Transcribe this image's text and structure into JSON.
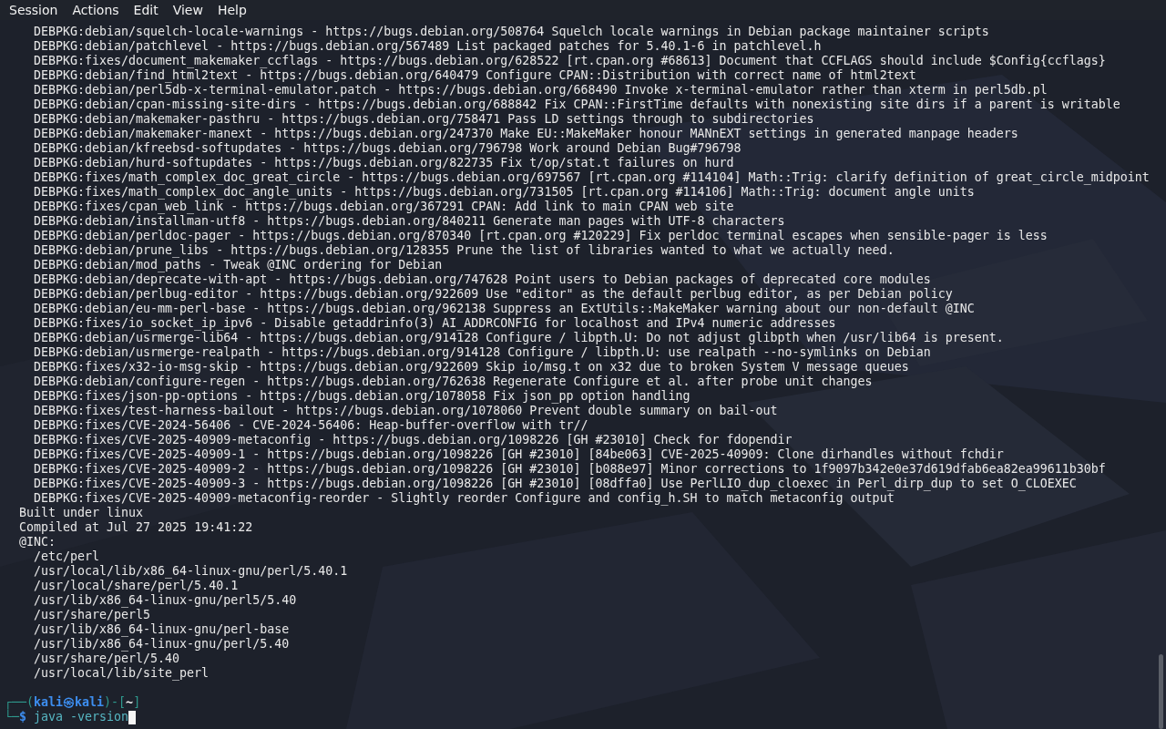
{
  "menu": [
    "Session",
    "Actions",
    "Edit",
    "View",
    "Help"
  ],
  "patches": [
    "DEBPKG:debian/squelch-locale-warnings - https://bugs.debian.org/508764 Squelch locale warnings in Debian package maintainer scripts",
    "DEBPKG:debian/patchlevel - https://bugs.debian.org/567489 List packaged patches for 5.40.1-6 in patchlevel.h",
    "DEBPKG:fixes/document_makemaker_ccflags - https://bugs.debian.org/628522 [rt.cpan.org #68613] Document that CCFLAGS should include $Config{ccflags}",
    "DEBPKG:debian/find_html2text - https://bugs.debian.org/640479 Configure CPAN::Distribution with correct name of html2text",
    "DEBPKG:debian/perl5db-x-terminal-emulator.patch - https://bugs.debian.org/668490 Invoke x-terminal-emulator rather than xterm in perl5db.pl",
    "DEBPKG:debian/cpan-missing-site-dirs - https://bugs.debian.org/688842 Fix CPAN::FirstTime defaults with nonexisting site dirs if a parent is writable",
    "DEBPKG:debian/makemaker-pasthru - https://bugs.debian.org/758471 Pass LD settings through to subdirectories",
    "DEBPKG:debian/makemaker-manext - https://bugs.debian.org/247370 Make EU::MakeMaker honour MANnEXT settings in generated manpage headers",
    "DEBPKG:debian/kfreebsd-softupdates - https://bugs.debian.org/796798 Work around Debian Bug#796798",
    "DEBPKG:debian/hurd-softupdates - https://bugs.debian.org/822735 Fix t/op/stat.t failures on hurd",
    "DEBPKG:fixes/math_complex_doc_great_circle - https://bugs.debian.org/697567 [rt.cpan.org #114104] Math::Trig: clarify definition of great_circle_midpoint",
    "DEBPKG:fixes/math_complex_doc_angle_units - https://bugs.debian.org/731505 [rt.cpan.org #114106] Math::Trig: document angle units",
    "DEBPKG:fixes/cpan_web_link - https://bugs.debian.org/367291 CPAN: Add link to main CPAN web site",
    "DEBPKG:debian/installman-utf8 - https://bugs.debian.org/840211 Generate man pages with UTF-8 characters",
    "DEBPKG:debian/perldoc-pager - https://bugs.debian.org/870340 [rt.cpan.org #120229] Fix perldoc terminal escapes when sensible-pager is less",
    "DEBPKG:debian/prune_libs - https://bugs.debian.org/128355 Prune the list of libraries wanted to what we actually need.",
    "DEBPKG:debian/mod_paths - Tweak @INC ordering for Debian",
    "DEBPKG:debian/deprecate-with-apt - https://bugs.debian.org/747628 Point users to Debian packages of deprecated core modules",
    "DEBPKG:debian/perlbug-editor - https://bugs.debian.org/922609 Use \"editor\" as the default perlbug editor, as per Debian policy",
    "DEBPKG:debian/eu-mm-perl-base - https://bugs.debian.org/962138 Suppress an ExtUtils::MakeMaker warning about our non-default @INC",
    "DEBPKG:fixes/io_socket_ip_ipv6 - Disable getaddrinfo(3) AI_ADDRCONFIG for localhost and IPv4 numeric addresses",
    "DEBPKG:debian/usrmerge-lib64 - https://bugs.debian.org/914128 Configure / libpth.U: Do not adjust glibpth when /usr/lib64 is present.",
    "DEBPKG:debian/usrmerge-realpath - https://bugs.debian.org/914128 Configure / libpth.U: use realpath --no-symlinks on Debian",
    "DEBPKG:fixes/x32-io-msg-skip - https://bugs.debian.org/922609 Skip io/msg.t on x32 due to broken System V message queues",
    "DEBPKG:debian/configure-regen - https://bugs.debian.org/762638 Regenerate Configure et al. after probe unit changes",
    "DEBPKG:fixes/json-pp-options - https://bugs.debian.org/1078058 Fix json_pp option handling",
    "DEBPKG:fixes/test-harness-bailout - https://bugs.debian.org/1078060 Prevent double summary on bail-out",
    "DEBPKG:fixes/CVE-2024-56406 - CVE-2024-56406: Heap-buffer-overflow with tr//",
    "DEBPKG:fixes/CVE-2025-40909-metaconfig - https://bugs.debian.org/1098226 [GH #23010] Check for fdopendir",
    "DEBPKG:fixes/CVE-2025-40909-1 - https://bugs.debian.org/1098226 [GH #23010] [84be063] CVE-2025-40909: Clone dirhandles without fchdir",
    "DEBPKG:fixes/CVE-2025-40909-2 - https://bugs.debian.org/1098226 [GH #23010] [b088e97] Minor corrections to 1f9097b342e0e37d619dfab6ea82ea99611b30bf",
    "DEBPKG:fixes/CVE-2025-40909-3 - https://bugs.debian.org/1098226 [GH #23010] [08dffa0] Use PerlLIO_dup_cloexec in Perl_dirp_dup to set O_CLOEXEC",
    "DEBPKG:fixes/CVE-2025-40909-metaconfig-reorder - Slightly reorder Configure and config_h.SH to match metaconfig output"
  ],
  "build_lines": [
    "Built under linux",
    "Compiled at Jul 27 2025 19:41:22",
    "@INC:"
  ],
  "inc_paths": [
    "/etc/perl",
    "/usr/local/lib/x86_64-linux-gnu/perl/5.40.1",
    "/usr/local/share/perl/5.40.1",
    "/usr/lib/x86_64-linux-gnu/perl5/5.40",
    "/usr/share/perl5",
    "/usr/lib/x86_64-linux-gnu/perl-base",
    "/usr/lib/x86_64-linux-gnu/perl/5.40",
    "/usr/share/perl/5.40",
    "/usr/local/lib/site_perl"
  ],
  "prompt": {
    "frame_open": "┌──(",
    "user_host": "kali㉿kali",
    "frame_mid": ")-[",
    "path": "~",
    "frame_close": "]",
    "frame_bottom": "└─",
    "symbol": "$",
    "command": "java -version"
  }
}
